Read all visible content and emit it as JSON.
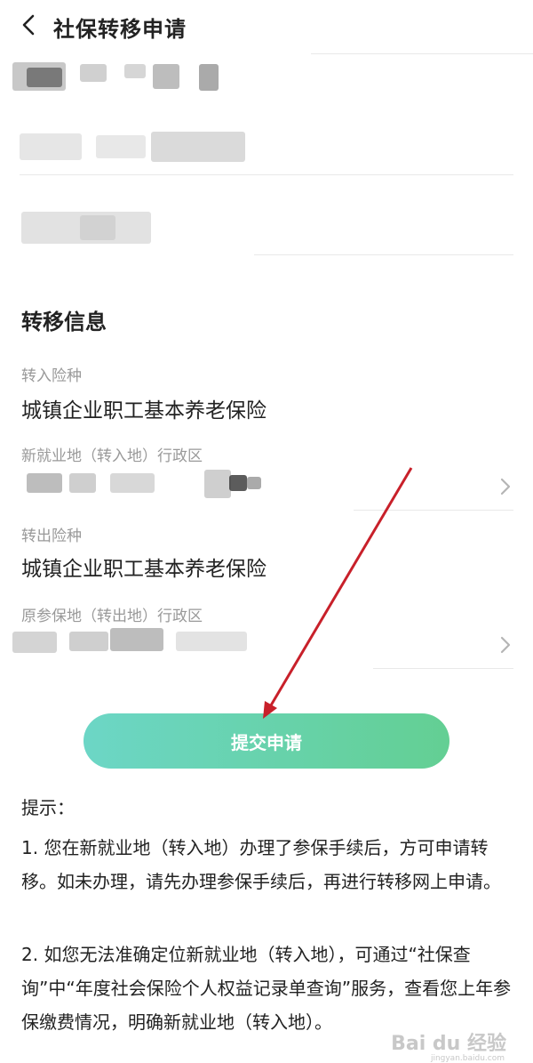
{
  "header": {
    "title": "社保转移申请"
  },
  "transfer": {
    "section_title": "转移信息",
    "in_type_label": "转入险种",
    "in_type_value": "城镇企业职工基本养老保险",
    "new_region_label": "新就业地（转入地）行政区",
    "out_type_label": "转出险种",
    "out_type_value": "城镇企业职工基本养老保险",
    "orig_region_label": "原参保地（转出地）行政区"
  },
  "submit_label": "提交申请",
  "tips": {
    "title": "提示：",
    "item1": "1. 您在新就业地（转入地）办理了参保手续后，方可申请转移。如未办理，请先办理参保手续后，再进行转移网上申请。",
    "item2": "2. 如您无法准确定位新就业地（转入地），可通过“社保查询”中“年度社会保险个人权益记录单查询”服务，查看您上年参保缴费情况，明确新就业地（转入地）。"
  },
  "watermark": {
    "main": "Bai du 经验",
    "sub": "jingyan.baidu.com"
  },
  "icons": {
    "back": "chevron-left-icon",
    "forward": "chevron-right-icon"
  },
  "colors": {
    "button_start": "#6cd6c6",
    "button_end": "#63cf93",
    "arrow": "#c8202a"
  }
}
